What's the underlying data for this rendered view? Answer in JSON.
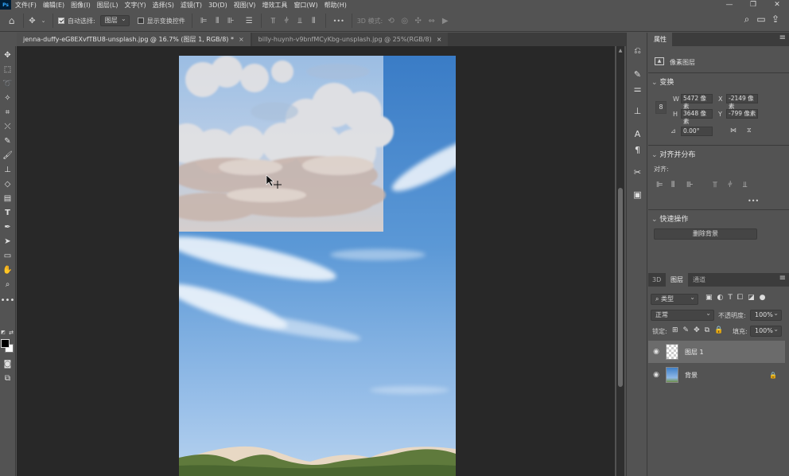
{
  "app": {
    "logo": "Ps"
  },
  "menu": [
    "文件(F)",
    "编辑(E)",
    "图像(I)",
    "图层(L)",
    "文字(Y)",
    "选择(S)",
    "滤镜(T)",
    "3D(D)",
    "视图(V)",
    "增效工具",
    "窗口(W)",
    "帮助(H)"
  ],
  "window_controls": {
    "minimize": "—",
    "restore": "❐",
    "close": "✕"
  },
  "options": {
    "auto_select_label": "自动选择:",
    "auto_select_checked": true,
    "auto_select_target": "图层",
    "show_transform_label": "显示变换控件",
    "show_transform_checked": false,
    "more": "•••",
    "mode_3d_label": "3D 模式:"
  },
  "tabs": [
    {
      "title": "jenna-duffy-eG8EXvfTBU8-unsplash.jpg @ 16.7% (图层 1, RGB/8) *",
      "close": "×",
      "active": true
    },
    {
      "title": "billy-huynh-v9bnfMCyKbg-unsplash.jpg @ 25%(RGB/8)",
      "close": "×",
      "active": false
    }
  ],
  "properties": {
    "tab": "属性",
    "layer_type": "像素图层",
    "transform": {
      "title": "变换",
      "w_label": "W",
      "w_value": "5472 像素",
      "x_label": "X",
      "x_value": "-2149 像素",
      "h_label": "H",
      "h_value": "3648 像素",
      "y_label": "Y",
      "y_value": "-799 像素",
      "angle": "0.00°"
    },
    "align": {
      "title": "对齐并分布",
      "label": "对齐:",
      "more": "•••"
    },
    "quick_actions": {
      "title": "快速操作",
      "remove_bg": "删除背景"
    }
  },
  "layers_panel": {
    "tabs": [
      "3D",
      "图层",
      "通道"
    ],
    "active_tab": "图层",
    "filter_kind": "类型",
    "blend_mode": "正常",
    "opacity_label": "不透明度:",
    "opacity_value": "100%",
    "lock_label": "锁定:",
    "fill_label": "填充:",
    "fill_value": "100%",
    "layers": [
      {
        "name": "图层 1",
        "selected": true,
        "visible": true,
        "locked": false
      },
      {
        "name": "背景",
        "selected": false,
        "visible": true,
        "locked": true
      }
    ]
  }
}
